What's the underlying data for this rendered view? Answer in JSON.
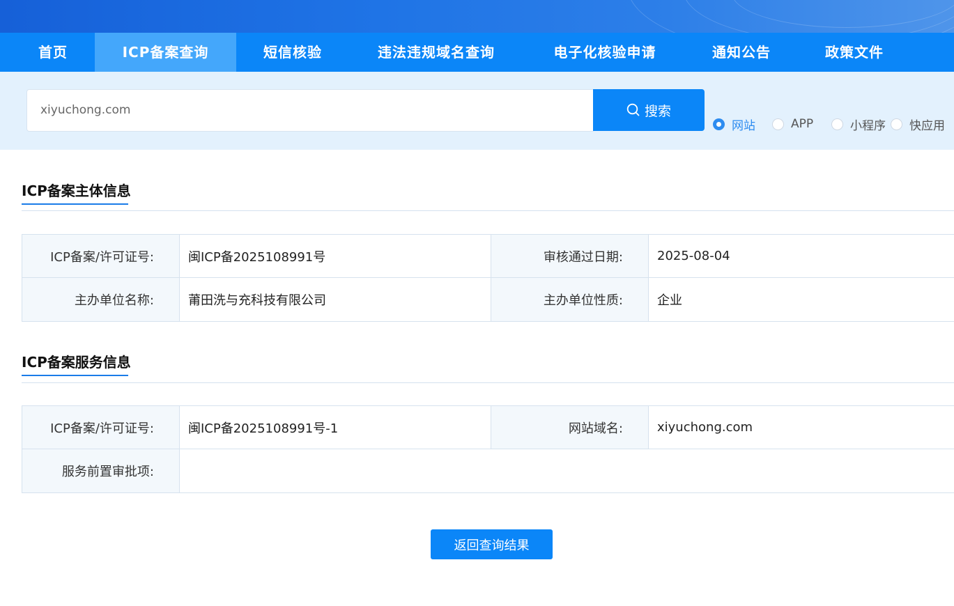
{
  "nav": {
    "items": [
      {
        "label": "首页"
      },
      {
        "label": "ICP备案查询"
      },
      {
        "label": "短信核验"
      },
      {
        "label": "违法违规域名查询"
      },
      {
        "label": "电子化核验申请"
      },
      {
        "label": "通知公告"
      },
      {
        "label": "政策文件"
      }
    ],
    "active_index": 1
  },
  "search": {
    "value": "xiyuchong.com",
    "button_label": "搜索",
    "types": [
      {
        "label": "网站",
        "checked": true
      },
      {
        "label": "APP",
        "checked": false
      },
      {
        "label": "小程序",
        "checked": false
      },
      {
        "label": "快应用",
        "checked": false
      }
    ]
  },
  "entity": {
    "title": "ICP备案主体信息",
    "license_label": "ICP备案/许可证号:",
    "license_value": "闽ICP备2025108991号",
    "approval_date_label": "审核通过日期:",
    "approval_date_value": "2025-08-04",
    "org_name_label": "主办单位名称:",
    "org_name_value": "莆田洗与充科技有限公司",
    "org_type_label": "主办单位性质:",
    "org_type_value": "企业"
  },
  "service": {
    "title": "ICP备案服务信息",
    "license_label": "ICP备案/许可证号:",
    "license_value": "闽ICP备2025108991号-1",
    "domain_label": "网站域名:",
    "domain_value": "xiyuchong.com",
    "pre_approval_label": "服务前置审批项:",
    "pre_approval_value": ""
  },
  "back_button_label": "返回查询结果"
}
